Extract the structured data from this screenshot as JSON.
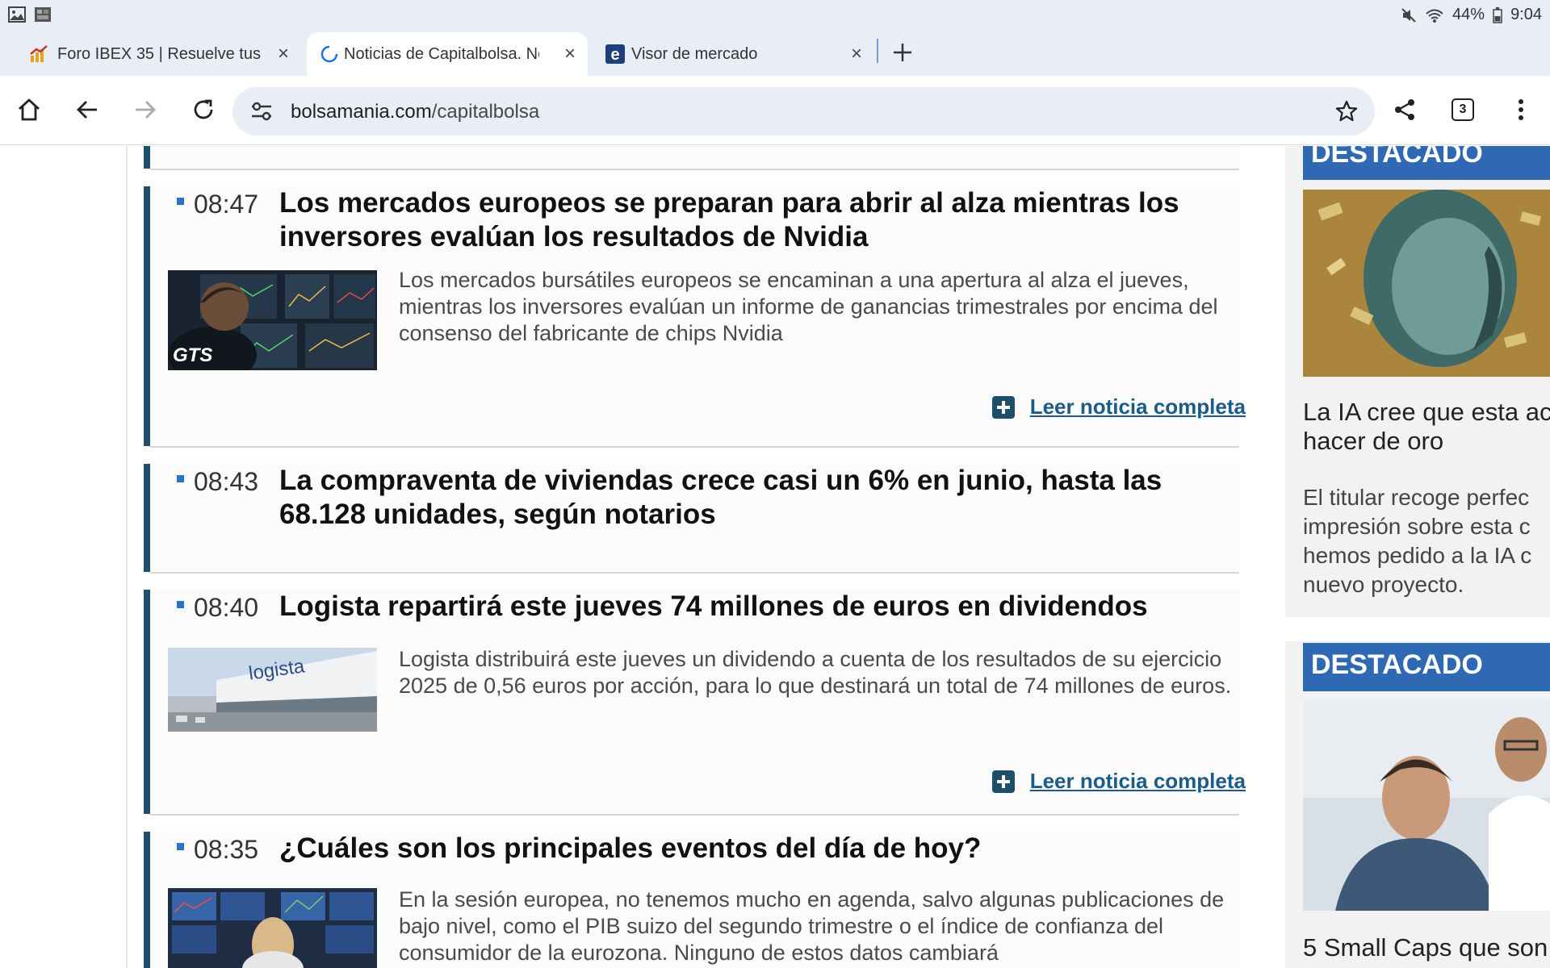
{
  "status_bar": {
    "battery": "44%",
    "time": "9:04"
  },
  "tabs": [
    {
      "title": "Foro IBEX 35 | Resuelve tus",
      "favicon": "chart-favicon"
    },
    {
      "title": "Noticias de Capitalbolsa. Noticias",
      "favicon": "loading-spinner-icon"
    },
    {
      "title": "Visor de mercado",
      "favicon": "e-favicon"
    }
  ],
  "toolbar": {
    "url_host": "bolsamania.com",
    "url_path": "/capitalbolsa",
    "tab_count": "3"
  },
  "news": [
    {
      "time": "08:47",
      "headline": "Los mercados europeos se preparan para abrir al alza mientras los inversores evalúan los resultados de Nvidia",
      "summary": "Los mercados bursátiles europeos se encaminan a una apertura al alza el jueves, mientras los inversores evalúan un informe de ganancias trimestrales por encima del consenso del fabricante de chips Nvidia",
      "thumb_text": "GTS",
      "more_label": "Leer noticia completa"
    },
    {
      "time": "08:43",
      "headline": "La compraventa de viviendas crece casi un 6% en junio, hasta las 68.128 unidades, según notarios"
    },
    {
      "time": "08:40",
      "headline": "Logista repartirá este jueves 74 millones de euros en dividendos",
      "summary": "Logista distribuirá este jueves un dividendo a cuenta de los resultados de su ejercicio 2025 de 0,56 euros por acción, para lo que destinará un total de 74 millones de euros.",
      "thumb_text": "logista",
      "more_label": "Leer noticia completa"
    },
    {
      "time": "08:35",
      "headline": "¿Cuáles son los principales eventos del día de hoy?",
      "summary": "En la sesión europea, no tenemos mucho en agenda, salvo algunas publicaciones de bajo nivel, como el PIB suizo del segundo trimestre o el índice de confianza del consumidor de la eurozona. Ninguno de estos datos cambiará"
    }
  ],
  "sidebar": {
    "card1": {
      "badge": "DESTACADO",
      "title_lines": [
        "La IA cree que esta ac",
        "hacer de oro"
      ],
      "text_lines": [
        "El titular recoge perfec",
        "impresión sobre esta c",
        "hemos pedido a la IA c",
        "nuevo proyecto."
      ]
    },
    "card2": {
      "badge": "DESTACADO",
      "title_lines": [
        "5 Small Caps que son"
      ]
    }
  },
  "colors": {
    "accent_border": "#1d4e6b",
    "badge_blue": "#2f68b3",
    "link": "#1b5c86",
    "bullet": "#2a73c9"
  }
}
